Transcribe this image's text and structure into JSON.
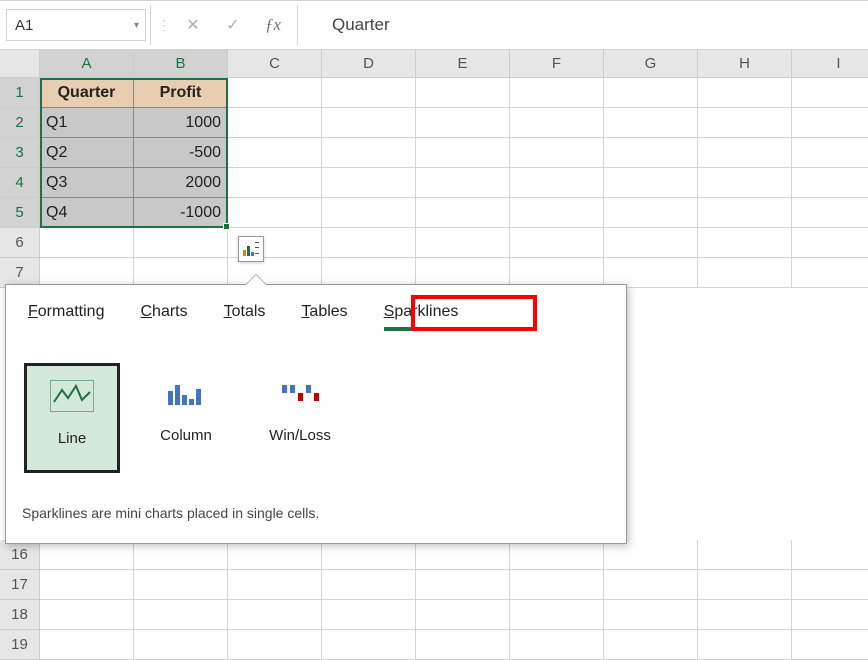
{
  "formulaBar": {
    "nameBox": "A1",
    "formulaText": "Quarter"
  },
  "columns": [
    "A",
    "B",
    "C",
    "D",
    "E",
    "F",
    "G",
    "H",
    "I"
  ],
  "rowsTop": [
    "1",
    "2",
    "3",
    "4",
    "5",
    "6",
    "7"
  ],
  "rowsBottom": [
    "16",
    "17",
    "18",
    "19"
  ],
  "tableData": {
    "headers": [
      "Quarter",
      "Profit"
    ],
    "rows": [
      {
        "quarter": "Q1",
        "profit": "1000"
      },
      {
        "quarter": "Q2",
        "profit": "-500"
      },
      {
        "quarter": "Q3",
        "profit": "2000"
      },
      {
        "quarter": "Q4",
        "profit": "-1000"
      }
    ]
  },
  "quickAnalysis": {
    "tabs": {
      "formatting": "ormatting",
      "formattingU": "F",
      "charts": "harts",
      "chartsU": "C",
      "totals": "otals",
      "totalsU": "T",
      "tables": "ables",
      "tablesU": "T",
      "sparklines": "parklines",
      "sparklinesU": "S"
    },
    "options": {
      "line": "Line",
      "column": "Column",
      "winloss": "Win/Loss"
    },
    "description": "Sparklines are mini charts placed in single cells."
  },
  "chart_data": {
    "type": "bar",
    "categories": [
      "Q1",
      "Q2",
      "Q3",
      "Q4"
    ],
    "series": [
      {
        "name": "Profit",
        "values": [
          1000,
          -500,
          2000,
          -1000
        ]
      }
    ],
    "title": "",
    "xlabel": "Quarter",
    "ylabel": "Profit"
  }
}
